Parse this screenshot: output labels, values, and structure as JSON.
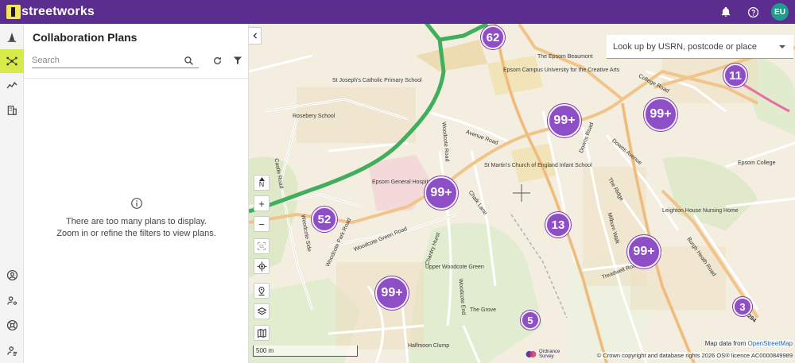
{
  "app": {
    "brand": "streetworks",
    "brand_digit": "1",
    "user_initials": "EU"
  },
  "panel": {
    "title": "Collaboration Plans",
    "search_placeholder": "Search",
    "empty_line1": "There are too many plans to display.",
    "empty_line2": "Zoom in or refine the filters to view plans."
  },
  "map": {
    "lookup_placeholder": "Look up by USRN, postcode or place",
    "north_label": "N",
    "zoom_in": "+",
    "zoom_out": "−",
    "scale": "500 m",
    "attribution_prefix": "Map data from",
    "attribution_link": "OpenStreetMap",
    "copyright": "© Crown copyright and database rights 2026 OS® licence AC0000849989",
    "os_logo_line1": "Ordnance",
    "os_logo_line2": "Survey",
    "clusters": [
      {
        "label": "62"
      },
      {
        "label": "11"
      },
      {
        "label": "99+"
      },
      {
        "label": "99+"
      },
      {
        "label": "99+"
      },
      {
        "label": "52"
      },
      {
        "label": "13"
      },
      {
        "label": "99+"
      },
      {
        "label": "99+"
      },
      {
        "label": "3"
      },
      {
        "label": "5"
      }
    ],
    "places": [
      "St Joseph's Catholic Primary School",
      "Rosebery School",
      "Epsom General Hospital",
      "St Martin's Church of England Infant School",
      "Epsom Campus University for the Creative Arts",
      "The Epsom Beaumont",
      "Epsom College",
      "Leighton House Nursing Home",
      "Upper Woodcote Green",
      "The Grove",
      "Halfmoon Clump"
    ],
    "roads": [
      "College Road",
      "Woodcote Road",
      "Avenue Road",
      "Downs Road",
      "Downs Avenue",
      "The Ridge",
      "Milburn Walk",
      "Treadwell Road",
      "Burgh Heath Road",
      "Castle Road",
      "Woodcote Side",
      "Woodcote Park Road",
      "Woodcote Green Road",
      "Chalk Lane",
      "Chantry Hurst",
      "Woodcote End",
      "B284"
    ]
  }
}
